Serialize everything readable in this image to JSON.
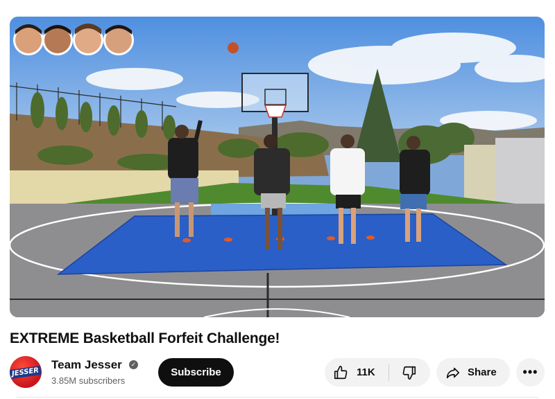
{
  "video": {
    "title": "EXTREME Basketball Forfeit Challenge!"
  },
  "channel": {
    "name": "Team Jesser",
    "subscribers": "3.85M subscribers",
    "verified_icon": "check-circle-icon",
    "avatar_logo": "JESSER"
  },
  "actions": {
    "subscribe_label": "Subscribe",
    "like_count": "11K",
    "share_label": "Share",
    "more_label": "•••"
  },
  "colors": {
    "subscribe_bg": "#0f0f0f",
    "pill_bg": "#f2f2f2",
    "tarp": "#2a5fc8",
    "court": "#8f8f92"
  }
}
